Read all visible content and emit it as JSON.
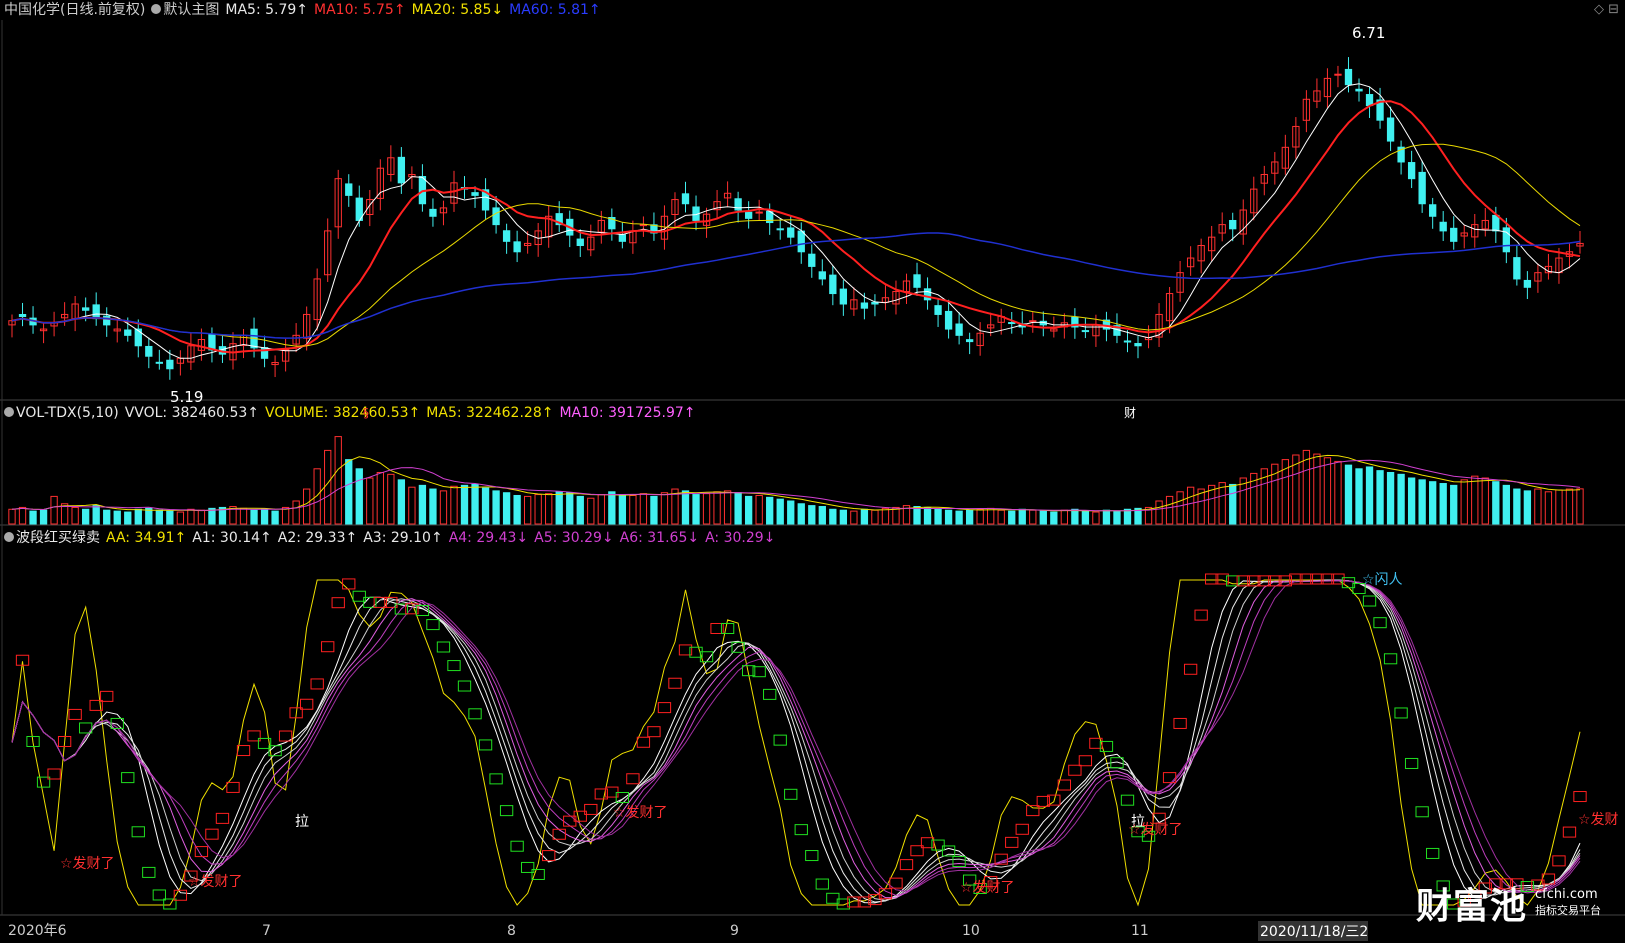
{
  "header_main": {
    "title": "中国化学(日线.前复权)",
    "template": "默认主图",
    "ma5": "MA5: 5.79↑",
    "ma10": "MA10: 5.75↑",
    "ma20": "MA20: 5.85↓",
    "ma60": "MA60: 5.81↑"
  },
  "header_vol": {
    "name": "VOL-TDX(5,10)",
    "vvol": "VVOL: 382460.53↑",
    "volume": "VOLUME: 382460.53↑",
    "ma5": "MA5: 322462.28↑",
    "ma10": "MA10: 391725.97↑"
  },
  "header_ind": {
    "name": "波段红买绿卖",
    "aa": "AA: 34.91↑",
    "a1": "A1: 30.14↑",
    "a2": "A2: 29.33↑",
    "a3": "A3: 29.10↑",
    "a4": "A4: 29.43↓",
    "a5": "A5: 30.29↓",
    "a6": "A6: 31.65↓",
    "a": "A: 30.29↓"
  },
  "annotations": {
    "high": "6.71",
    "low": "5.19",
    "mark_s": "§",
    "mark_cai": "财",
    "la1": "拉",
    "la2": "拉",
    "fa1": "☆发财了",
    "fa2": "☆发财了",
    "fa3": "☆发财了",
    "fa4": "☆发财了",
    "fa5": "☆发财了",
    "fa6": "☆发财",
    "shan": "☆闪人"
  },
  "x_axis": {
    "labels": [
      "2020年6",
      "7",
      "8",
      "9",
      "10",
      "11",
      "2020/11/18/三2"
    ]
  },
  "logo": {
    "main": "财富池",
    "domain": "cfchi.com",
    "sub": "指标交易平台"
  },
  "colors": {
    "up": "#ff3030",
    "down": "#40f0f0",
    "ma5": "#ffffff",
    "ma10": "#ff2020",
    "ma20": "#e8d800",
    "ma60": "#2030d0"
  },
  "chart_data": [
    {
      "type": "candlestick",
      "title": "中国化学(日线.前复权)",
      "series": [
        {
          "name": "MA5",
          "value": 5.79
        },
        {
          "name": "MA10",
          "value": 5.75
        },
        {
          "name": "MA20",
          "value": 5.85
        },
        {
          "name": "MA60",
          "value": 5.81
        }
      ],
      "close": [
        5.42,
        5.44,
        5.4,
        5.38,
        5.41,
        5.45,
        5.5,
        5.47,
        5.43,
        5.4,
        5.38,
        5.35,
        5.3,
        5.25,
        5.22,
        5.19,
        5.24,
        5.3,
        5.33,
        5.28,
        5.26,
        5.31,
        5.35,
        5.29,
        5.24,
        5.22,
        5.28,
        5.35,
        5.45,
        5.62,
        5.85,
        6.1,
        6.02,
        5.9,
        6.0,
        6.15,
        6.2,
        6.08,
        6.12,
        5.98,
        5.92,
        5.96,
        6.08,
        6.05,
        6.02,
        5.95,
        5.88,
        5.8,
        5.75,
        5.79,
        5.85,
        5.92,
        5.88,
        5.83,
        5.78,
        5.82,
        5.9,
        5.86,
        5.8,
        5.85,
        5.88,
        5.84,
        5.92,
        6.0,
        5.98,
        5.9,
        5.93,
        5.99,
        6.03,
        5.95,
        5.91,
        5.94,
        5.89,
        5.86,
        5.82,
        5.75,
        5.68,
        5.62,
        5.55,
        5.5,
        5.52,
        5.48,
        5.5,
        5.53,
        5.56,
        5.61,
        5.58,
        5.52,
        5.45,
        5.38,
        5.35,
        5.32,
        5.36,
        5.4,
        5.44,
        5.41,
        5.39,
        5.42,
        5.4,
        5.38,
        5.41,
        5.39,
        5.37,
        5.4,
        5.38,
        5.35,
        5.32,
        5.3,
        5.34,
        5.45,
        5.55,
        5.65,
        5.72,
        5.78,
        5.82,
        5.88,
        5.86,
        5.95,
        6.05,
        6.12,
        6.18,
        6.25,
        6.35,
        6.48,
        6.52,
        6.58,
        6.6,
        6.55,
        6.52,
        6.45,
        6.38,
        6.28,
        6.18,
        6.1,
        5.98,
        5.92,
        5.85,
        5.8,
        5.84,
        5.88,
        5.9,
        5.85,
        5.75,
        5.62,
        5.58,
        5.65,
        5.68,
        5.72,
        5.75,
        5.79
      ],
      "high_label": 6.71,
      "low_label": 5.19
    },
    {
      "type": "bar",
      "title": "VOL-TDX(5,10)",
      "series": [
        {
          "name": "VOLUME",
          "value": 382460.53
        },
        {
          "name": "MA5",
          "value": 322462.28
        },
        {
          "name": "MA10",
          "value": 391725.97
        }
      ],
      "values": [
        160,
        180,
        140,
        150,
        300,
        220,
        180,
        160,
        200,
        150,
        140,
        130,
        160,
        170,
        150,
        140,
        130,
        160,
        150,
        170,
        180,
        190,
        170,
        150,
        160,
        140,
        180,
        250,
        380,
        600,
        800,
        950,
        700,
        600,
        500,
        560,
        540,
        480,
        400,
        420,
        380,
        360,
        410,
        420,
        430,
        390,
        360,
        340,
        310,
        300,
        320,
        330,
        350,
        340,
        300,
        280,
        320,
        350,
        320,
        310,
        330,
        300,
        340,
        380,
        360,
        320,
        330,
        350,
        360,
        340,
        300,
        310,
        290,
        270,
        250,
        220,
        200,
        190,
        160,
        150,
        140,
        160,
        150,
        170,
        180,
        200,
        190,
        180,
        160,
        150,
        140,
        150,
        160,
        170,
        150,
        140,
        160,
        150,
        140,
        130,
        150,
        160,
        140,
        130,
        150,
        140,
        160,
        170,
        180,
        250,
        300,
        350,
        400,
        380,
        420,
        450,
        430,
        500,
        550,
        600,
        650,
        700,
        750,
        800,
        760,
        720,
        680,
        640,
        600,
        620,
        580,
        560,
        540,
        500,
        480,
        460,
        440,
        420,
        480,
        520,
        500,
        460,
        420,
        380,
        360,
        380,
        350,
        370,
        380,
        382
      ]
    },
    {
      "type": "line",
      "title": "波段红买绿卖",
      "series": [
        {
          "name": "AA",
          "value": 34.91
        },
        {
          "name": "A1",
          "value": 30.14
        },
        {
          "name": "A2",
          "value": 29.33
        },
        {
          "name": "A3",
          "value": 29.1
        },
        {
          "name": "A4",
          "value": 29.43
        },
        {
          "name": "A5",
          "value": 30.29
        },
        {
          "name": "A6",
          "value": 31.65
        },
        {
          "name": "A",
          "value": 30.29
        }
      ]
    }
  ]
}
